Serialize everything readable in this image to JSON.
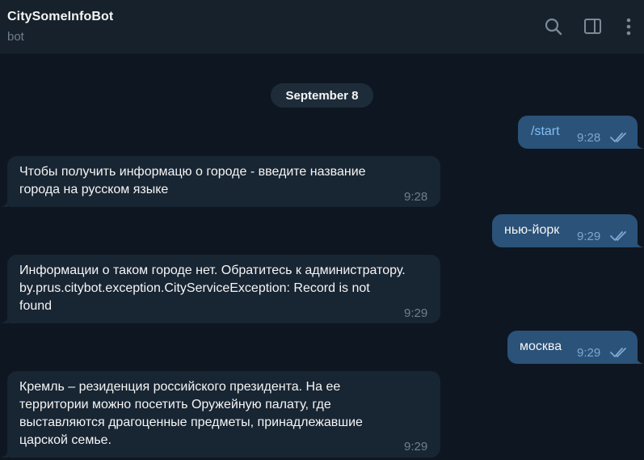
{
  "header": {
    "title": "CitySomeInfoBot",
    "status": "bot"
  },
  "icons": {
    "search": "search-icon",
    "panel": "sidebar-panel-icon",
    "more": "more-vertical-icon"
  },
  "date_badge": "September 8",
  "messages": [
    {
      "direction": "out",
      "lines": [
        "/start"
      ],
      "time": "9:28",
      "read": true
    },
    {
      "direction": "in",
      "lines": [
        "Чтобы получить информацю о городе - введите название",
        "города на русском языке"
      ],
      "time": "9:28"
    },
    {
      "direction": "out",
      "lines": [
        "нью-йорк"
      ],
      "time": "9:29",
      "read": true
    },
    {
      "direction": "in",
      "lines": [
        "Информации о таком городе нет. Обратитесь к администратору.",
        "by.prus.citybot.exception.CityServiceException: Record is not",
        "found"
      ],
      "time": "9:29"
    },
    {
      "direction": "out",
      "lines": [
        "москва"
      ],
      "time": "9:29",
      "read": true
    },
    {
      "direction": "in",
      "lines": [
        "Кремль – резиденция российского президента. На ее",
        "территории можно посетить Оружейную палату, где",
        "выставляются драгоценные предметы, принадлежавшие",
        "царской семье."
      ],
      "time": "9:29"
    }
  ],
  "colors": {
    "background": "#0e1621",
    "header": "#17212b",
    "incoming_bubble": "#182533",
    "outgoing_bubble": "#2b5278",
    "read_check": "#7da8d3"
  }
}
